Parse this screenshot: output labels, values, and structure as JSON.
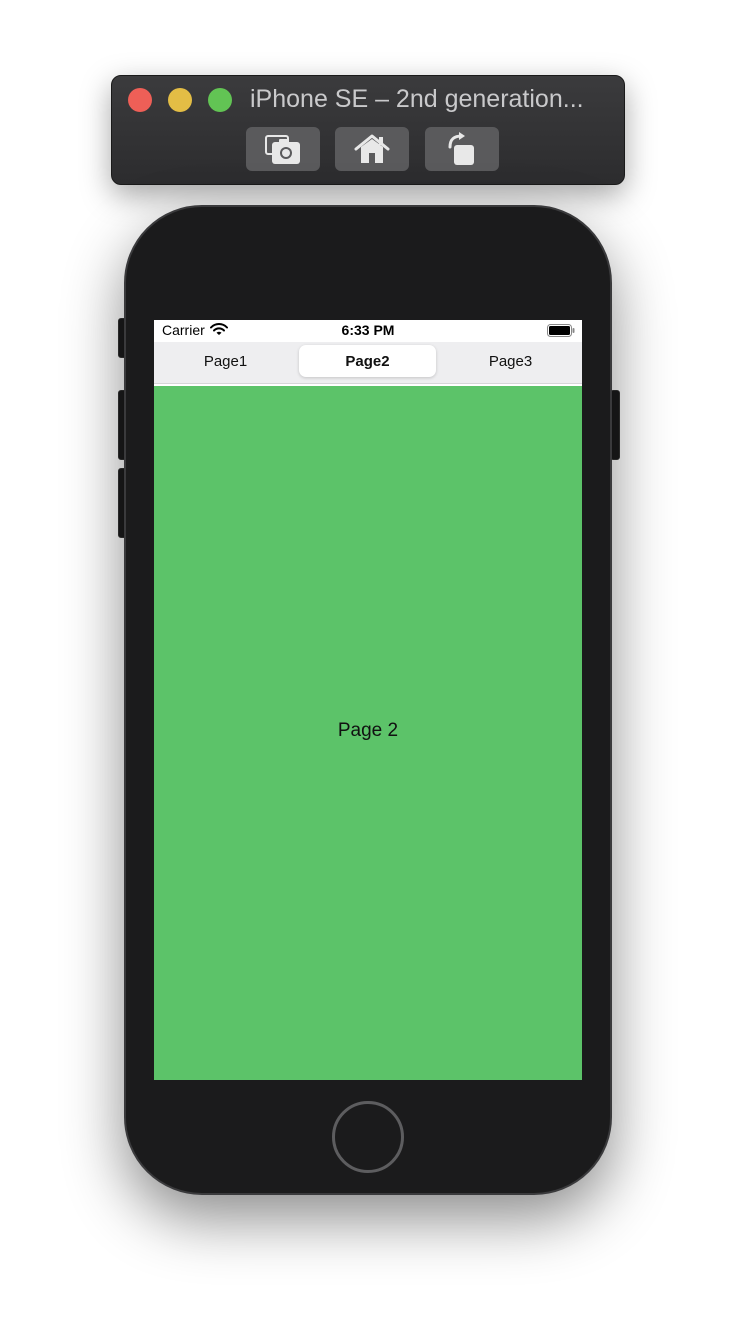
{
  "simulator": {
    "title": "iPhone SE – 2nd generation...",
    "toolbar": [
      {
        "icon": "screenshot-icon"
      },
      {
        "icon": "home-icon"
      },
      {
        "icon": "rotate-icon"
      }
    ]
  },
  "status_bar": {
    "carrier": "Carrier",
    "time": "6:33 PM"
  },
  "tabs": [
    {
      "label": "Page1",
      "selected": false
    },
    {
      "label": "Page2",
      "selected": true
    },
    {
      "label": "Page3",
      "selected": false
    }
  ],
  "content": {
    "label": "Page 2",
    "background": "#5cc369"
  }
}
